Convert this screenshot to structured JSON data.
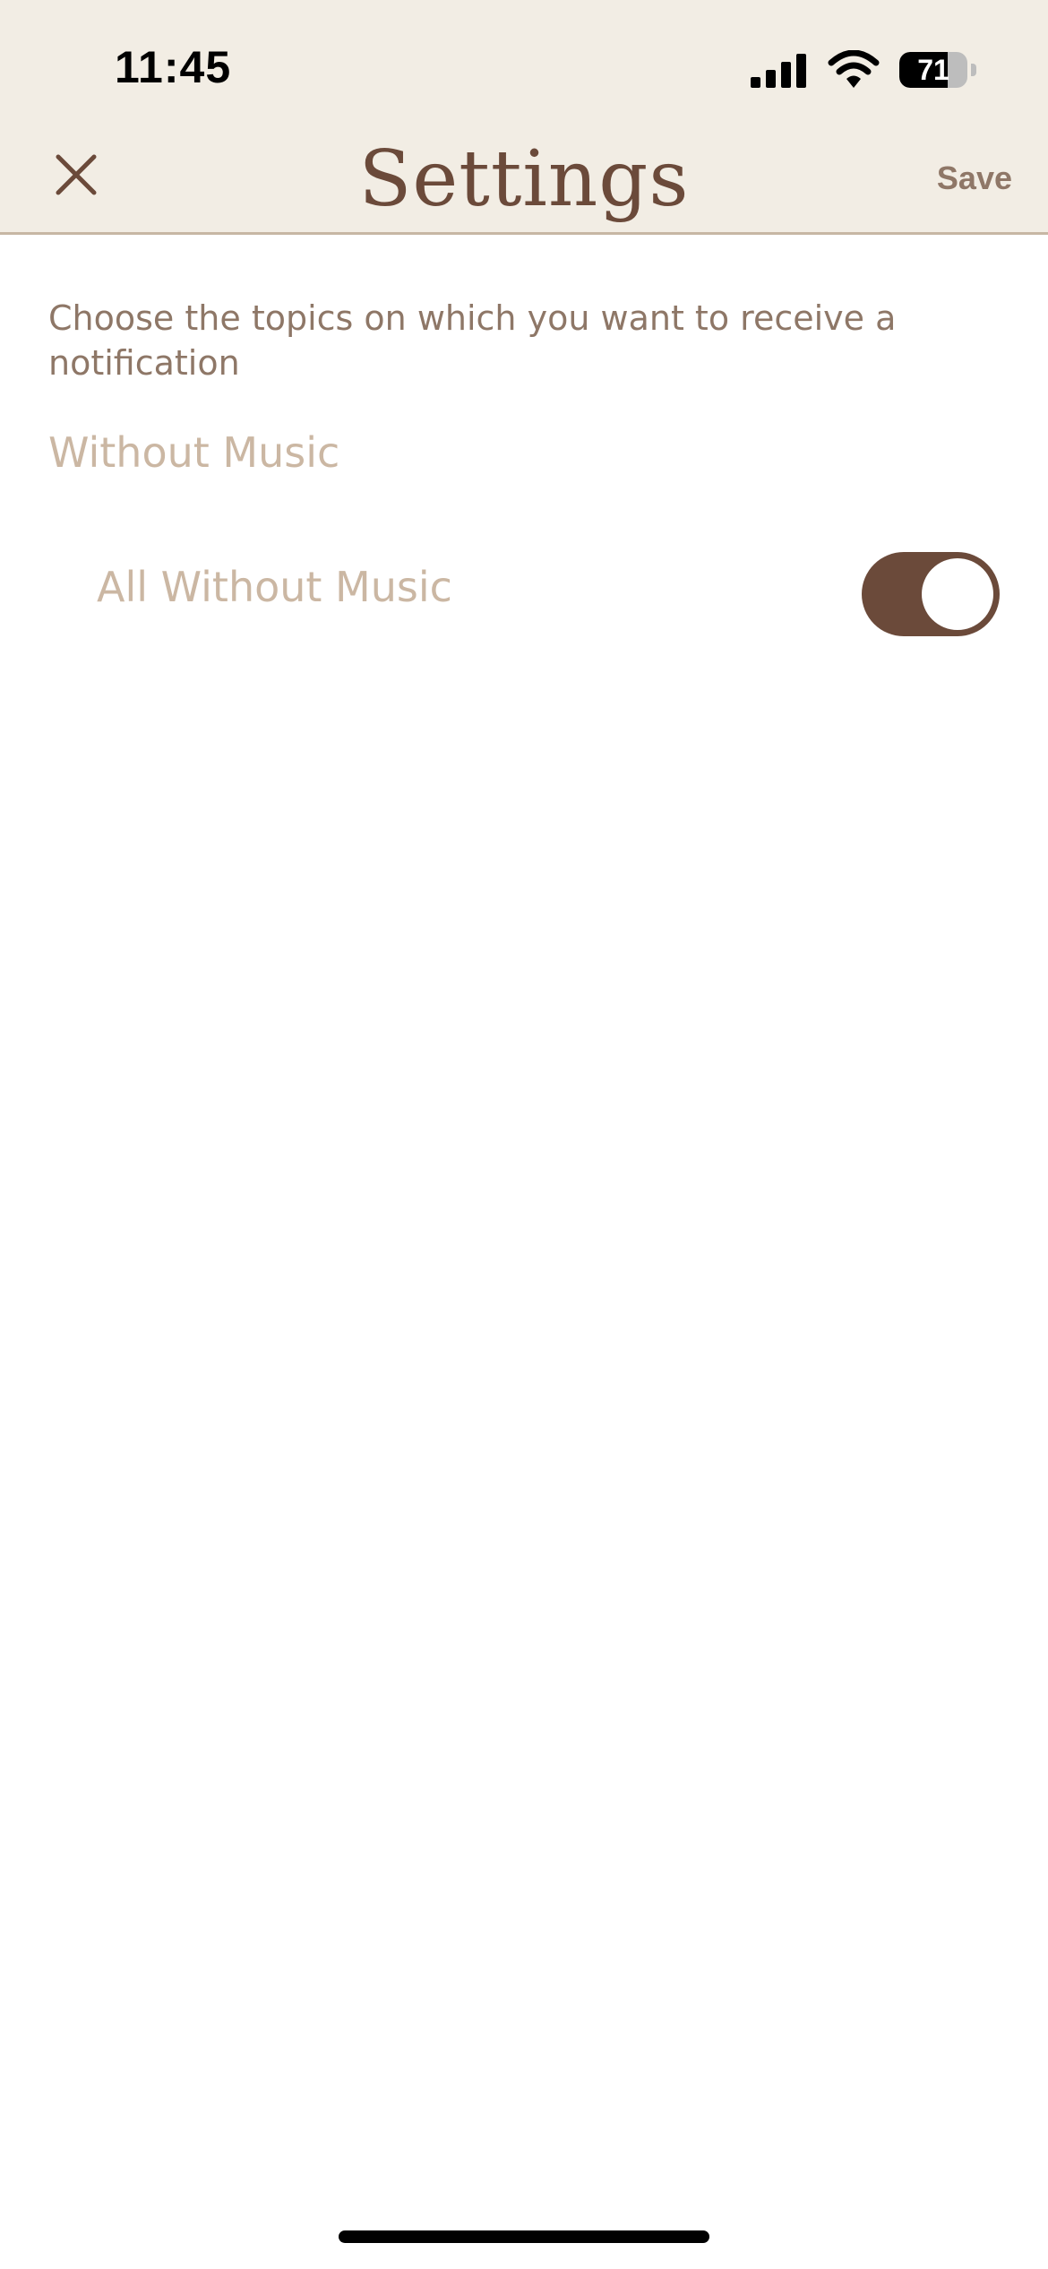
{
  "status_bar": {
    "time": "11:45",
    "battery": "71",
    "battery_level": 0.71,
    "icons": [
      "signal-bars-icon",
      "wifi-icon",
      "battery-icon"
    ]
  },
  "nav": {
    "close_icon": "close-icon",
    "title": "Settings",
    "save_label": "Save"
  },
  "content": {
    "intro": "Choose the topics on which you want to receive a notification",
    "section_title": "Without Music",
    "items": [
      {
        "label": "All Without Music",
        "enabled": true
      }
    ]
  },
  "colors": {
    "header_bg": "#f2ede4",
    "header_border": "#c7b7a4",
    "brand_brown": "#6b4a3a",
    "text_muted": "#8e7767",
    "text_light": "#cbb7a3"
  }
}
